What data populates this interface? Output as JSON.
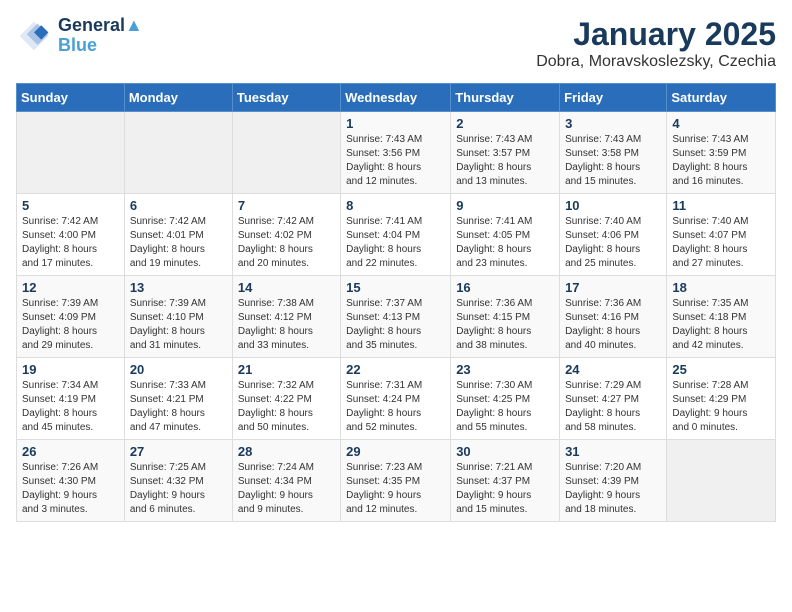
{
  "header": {
    "logo_line1": "General",
    "logo_line2": "Blue",
    "title": "January 2025",
    "subtitle": "Dobra, Moravskoslezsky, Czechia"
  },
  "weekdays": [
    "Sunday",
    "Monday",
    "Tuesday",
    "Wednesday",
    "Thursday",
    "Friday",
    "Saturday"
  ],
  "weeks": [
    [
      {
        "day": "",
        "info": ""
      },
      {
        "day": "",
        "info": ""
      },
      {
        "day": "",
        "info": ""
      },
      {
        "day": "1",
        "info": "Sunrise: 7:43 AM\nSunset: 3:56 PM\nDaylight: 8 hours\nand 12 minutes."
      },
      {
        "day": "2",
        "info": "Sunrise: 7:43 AM\nSunset: 3:57 PM\nDaylight: 8 hours\nand 13 minutes."
      },
      {
        "day": "3",
        "info": "Sunrise: 7:43 AM\nSunset: 3:58 PM\nDaylight: 8 hours\nand 15 minutes."
      },
      {
        "day": "4",
        "info": "Sunrise: 7:43 AM\nSunset: 3:59 PM\nDaylight: 8 hours\nand 16 minutes."
      }
    ],
    [
      {
        "day": "5",
        "info": "Sunrise: 7:42 AM\nSunset: 4:00 PM\nDaylight: 8 hours\nand 17 minutes."
      },
      {
        "day": "6",
        "info": "Sunrise: 7:42 AM\nSunset: 4:01 PM\nDaylight: 8 hours\nand 19 minutes."
      },
      {
        "day": "7",
        "info": "Sunrise: 7:42 AM\nSunset: 4:02 PM\nDaylight: 8 hours\nand 20 minutes."
      },
      {
        "day": "8",
        "info": "Sunrise: 7:41 AM\nSunset: 4:04 PM\nDaylight: 8 hours\nand 22 minutes."
      },
      {
        "day": "9",
        "info": "Sunrise: 7:41 AM\nSunset: 4:05 PM\nDaylight: 8 hours\nand 23 minutes."
      },
      {
        "day": "10",
        "info": "Sunrise: 7:40 AM\nSunset: 4:06 PM\nDaylight: 8 hours\nand 25 minutes."
      },
      {
        "day": "11",
        "info": "Sunrise: 7:40 AM\nSunset: 4:07 PM\nDaylight: 8 hours\nand 27 minutes."
      }
    ],
    [
      {
        "day": "12",
        "info": "Sunrise: 7:39 AM\nSunset: 4:09 PM\nDaylight: 8 hours\nand 29 minutes."
      },
      {
        "day": "13",
        "info": "Sunrise: 7:39 AM\nSunset: 4:10 PM\nDaylight: 8 hours\nand 31 minutes."
      },
      {
        "day": "14",
        "info": "Sunrise: 7:38 AM\nSunset: 4:12 PM\nDaylight: 8 hours\nand 33 minutes."
      },
      {
        "day": "15",
        "info": "Sunrise: 7:37 AM\nSunset: 4:13 PM\nDaylight: 8 hours\nand 35 minutes."
      },
      {
        "day": "16",
        "info": "Sunrise: 7:36 AM\nSunset: 4:15 PM\nDaylight: 8 hours\nand 38 minutes."
      },
      {
        "day": "17",
        "info": "Sunrise: 7:36 AM\nSunset: 4:16 PM\nDaylight: 8 hours\nand 40 minutes."
      },
      {
        "day": "18",
        "info": "Sunrise: 7:35 AM\nSunset: 4:18 PM\nDaylight: 8 hours\nand 42 minutes."
      }
    ],
    [
      {
        "day": "19",
        "info": "Sunrise: 7:34 AM\nSunset: 4:19 PM\nDaylight: 8 hours\nand 45 minutes."
      },
      {
        "day": "20",
        "info": "Sunrise: 7:33 AM\nSunset: 4:21 PM\nDaylight: 8 hours\nand 47 minutes."
      },
      {
        "day": "21",
        "info": "Sunrise: 7:32 AM\nSunset: 4:22 PM\nDaylight: 8 hours\nand 50 minutes."
      },
      {
        "day": "22",
        "info": "Sunrise: 7:31 AM\nSunset: 4:24 PM\nDaylight: 8 hours\nand 52 minutes."
      },
      {
        "day": "23",
        "info": "Sunrise: 7:30 AM\nSunset: 4:25 PM\nDaylight: 8 hours\nand 55 minutes."
      },
      {
        "day": "24",
        "info": "Sunrise: 7:29 AM\nSunset: 4:27 PM\nDaylight: 8 hours\nand 58 minutes."
      },
      {
        "day": "25",
        "info": "Sunrise: 7:28 AM\nSunset: 4:29 PM\nDaylight: 9 hours\nand 0 minutes."
      }
    ],
    [
      {
        "day": "26",
        "info": "Sunrise: 7:26 AM\nSunset: 4:30 PM\nDaylight: 9 hours\nand 3 minutes."
      },
      {
        "day": "27",
        "info": "Sunrise: 7:25 AM\nSunset: 4:32 PM\nDaylight: 9 hours\nand 6 minutes."
      },
      {
        "day": "28",
        "info": "Sunrise: 7:24 AM\nSunset: 4:34 PM\nDaylight: 9 hours\nand 9 minutes."
      },
      {
        "day": "29",
        "info": "Sunrise: 7:23 AM\nSunset: 4:35 PM\nDaylight: 9 hours\nand 12 minutes."
      },
      {
        "day": "30",
        "info": "Sunrise: 7:21 AM\nSunset: 4:37 PM\nDaylight: 9 hours\nand 15 minutes."
      },
      {
        "day": "31",
        "info": "Sunrise: 7:20 AM\nSunset: 4:39 PM\nDaylight: 9 hours\nand 18 minutes."
      },
      {
        "day": "",
        "info": ""
      }
    ]
  ]
}
